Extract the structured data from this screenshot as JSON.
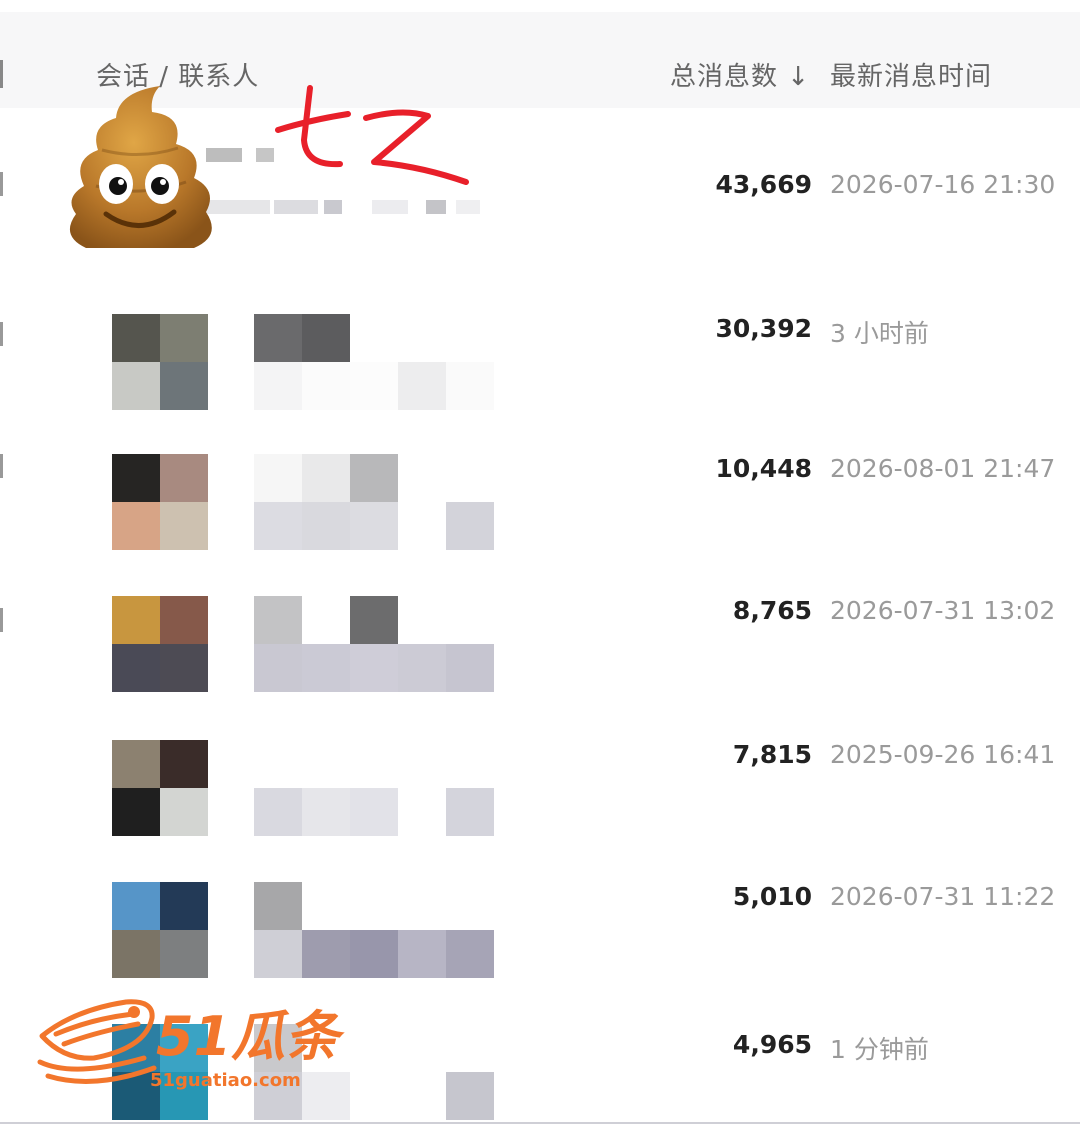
{
  "header": {
    "conversation_col": "会话 / 联系人",
    "count_col": "总消息数 ↓",
    "time_col": "最新消息时间"
  },
  "rows": [
    {
      "count": "43,669",
      "time": "2026-07-16 21:30"
    },
    {
      "count": "30,392",
      "time": "3 小时前"
    },
    {
      "count": "10,448",
      "time": "2026-08-01 21:47"
    },
    {
      "count": "8,765",
      "time": "2026-07-31 13:02"
    },
    {
      "count": "7,815",
      "time": "2025-09-26 16:41"
    },
    {
      "count": "5,010",
      "time": "2026-07-31 11:22"
    },
    {
      "count": "4,965",
      "time": "1 分钟前"
    }
  ],
  "annotation": {
    "scrawl": "七Z"
  },
  "watermark": {
    "brand": "51瓜条",
    "url": "51guatiao.com"
  },
  "colors": {
    "accent": "#f2762c",
    "header_bg": "#f7f7f8",
    "scrawl": "#e8202a"
  }
}
